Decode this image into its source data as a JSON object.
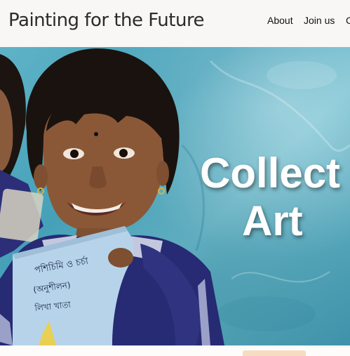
{
  "header": {
    "site_title": "Painting for the Future",
    "nav": [
      {
        "label": "About"
      },
      {
        "label": "Join us"
      },
      {
        "label": "C"
      }
    ]
  },
  "hero": {
    "heading_line1": "Collect",
    "heading_line2": "Art",
    "image": "photo-of-smiling-child-holding-book",
    "colors": {
      "wall": "#5fb3c7",
      "uniform": "#2a2f7a"
    }
  },
  "cta": {
    "color": "#f6dcc0"
  }
}
